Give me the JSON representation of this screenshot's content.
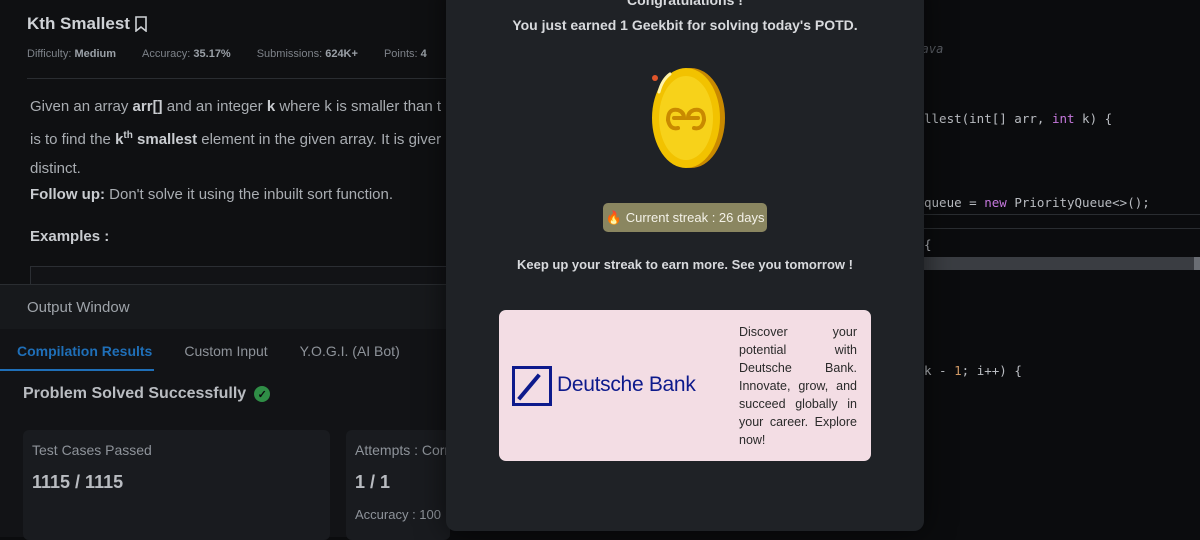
{
  "problem": {
    "title": "Kth Smallest",
    "difficulty_label": "Difficulty:",
    "difficulty": "Medium",
    "accuracy_label": "Accuracy:",
    "accuracy": "35.17%",
    "submissions_label": "Submissions:",
    "submissions": "624K+",
    "points_label": "Points:",
    "points": "4",
    "desc_line1_pre": "Given an array ",
    "desc_arr": "arr[]",
    "desc_line1_mid": " and an integer ",
    "desc_k": "k",
    "desc_line1_post": " where k is smaller than t",
    "desc_line2_pre": "is to find the ",
    "desc_kth": "k",
    "desc_sup": "th",
    "desc_smallest": " smallest",
    "desc_line2_post": " element in the given array. It is giver",
    "desc_line3": "distinct.",
    "followup_label": "Follow up:",
    "followup_text": " Don't solve it using the inbuilt sort function.",
    "examples_label": "Examples :"
  },
  "output": {
    "title": "Output Window",
    "tabs": [
      "Compilation Results",
      "Custom Input",
      "Y.O.G.I. (AI Bot)"
    ],
    "status": "Problem Solved Successfully",
    "card1_label": "Test Cases Passed",
    "card1_value": "1115 / 1115",
    "card2_label": "Attempts : Corr",
    "card2_value": "1 / 1",
    "card2_acc": "Accuracy : 100"
  },
  "editor": {
    "language": "r Java",
    "lines": [
      {
        "a": "llest(int[] arr, ",
        "kw": "int",
        "b": " k) {"
      },
      {
        "a": "",
        "kw": "",
        "b": ""
      },
      {
        "a": "queue = ",
        "kw": "new",
        "b": " PriorityQueue<>();"
      },
      {
        "a": "{",
        "kw": "",
        "b": ""
      },
      {
        "a": "",
        "kw": "",
        "b": ""
      },
      {
        "a": "",
        "kw": "",
        "b": ""
      },
      {
        "a": "k - ",
        "kw": "1",
        "b": "; i++) {"
      }
    ]
  },
  "modal": {
    "congrats": "Congratulations !",
    "earned": "You just earned 1 Geekbit for solving today's POTD.",
    "streak_icon": "fire-emoji",
    "streak_text": "Current streak : 26 days",
    "keepup": "Keep up your streak to earn more. See you tomorrow !",
    "ad_brand": "Deutsche Bank",
    "ad_text": "Discover your potential with Deutsche Bank. Innovate, grow, and succeed globally in your career. Explore now!",
    "colors": {
      "streak_bg": "#8a8660",
      "ad_bg": "#f3dde4",
      "brand_blue": "#0d1a8c",
      "coin": "#f2c200"
    }
  }
}
